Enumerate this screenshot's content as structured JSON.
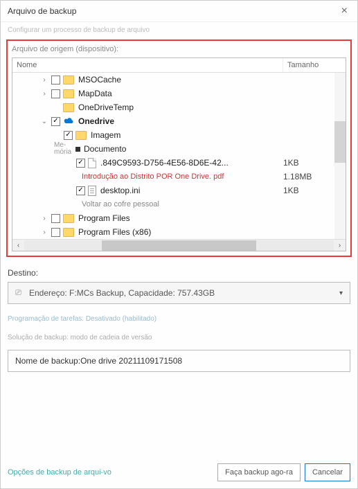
{
  "window": {
    "title": "Arquivo de backup",
    "subtitle": "Configurar um processo de backup de arquivo"
  },
  "source": {
    "label": "Arquivo de origem (dispositivo):",
    "columns": {
      "name": "Nome",
      "size": "Tamanho"
    },
    "tree": [
      {
        "indent": 1,
        "expander": "›",
        "checked": false,
        "icon": "folder",
        "label": "MSOCache",
        "size": ""
      },
      {
        "indent": 1,
        "expander": "›",
        "checked": false,
        "icon": "folder",
        "label": "MapData",
        "size": ""
      },
      {
        "indent": 1,
        "expander": "",
        "checked": null,
        "icon": "folder",
        "label": "OneDriveTemp",
        "size": ""
      },
      {
        "indent": 1,
        "expander": "⌄",
        "checked": true,
        "icon": "cloud",
        "label": "Onedrive",
        "size": "",
        "bold": true
      },
      {
        "indent": 2,
        "expander": "",
        "checked": true,
        "icon": "folder",
        "label": "Imagem",
        "size": ""
      },
      {
        "indent": 2,
        "expander": "",
        "checked": null,
        "icon": "square",
        "label": "Documento",
        "size": "",
        "memoLabel": "Me-\nmória"
      },
      {
        "indent": 3,
        "expander": "",
        "checked": true,
        "icon": "file",
        "label": ".849C9593-D756-4E56-8D6E-42...",
        "size": "1KB"
      },
      {
        "indent": 0,
        "expander": "",
        "checked": null,
        "icon": "none",
        "label": "Introdução ao Distrito POR One Drive. pdf",
        "size": "1.18MB",
        "red": true,
        "padLabel": true
      },
      {
        "indent": 3,
        "expander": "",
        "checked": true,
        "icon": "doc",
        "label": "desktop.ini",
        "size": "1KB"
      },
      {
        "indent": 0,
        "expander": "",
        "checked": null,
        "icon": "none",
        "label": "Voltar ao cofre pessoal",
        "size": "",
        "sub": true,
        "padLabel": true
      },
      {
        "indent": 1,
        "expander": "›",
        "checked": false,
        "icon": "folder",
        "label": "Program Files",
        "size": ""
      },
      {
        "indent": 1,
        "expander": "›",
        "checked": false,
        "icon": "folder",
        "label": "Program Files (x86)",
        "size": ""
      }
    ]
  },
  "dest": {
    "label": "Destino:",
    "text": "Endereço: F:MCs Backup, Capacidade: 757.43GB"
  },
  "schedule": {
    "text": "Programação de tarefas: Desativado (habilitado)"
  },
  "scheme": {
    "text": "Solução de backup: modo de cadeia de versão"
  },
  "backupName": {
    "prefix": "Nome de backup: ",
    "value": "One drive 20211109171508"
  },
  "footer": {
    "advanced": "Opções de backup de arqui-vo",
    "backupNow": "Faça backup ago-ra",
    "cancel": "Cancelar"
  }
}
